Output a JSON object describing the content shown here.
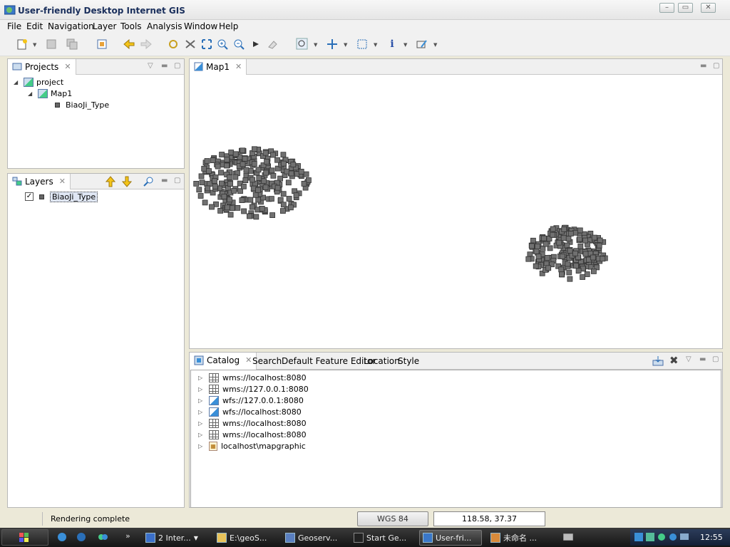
{
  "window": {
    "title": "User-friendly Desktop Internet GIS"
  },
  "menu": [
    "File",
    "Edit",
    "Navigation",
    "Layer",
    "Tools",
    "Analysis",
    "Window",
    "Help"
  ],
  "projects_panel": {
    "tab_label": "Projects",
    "tree": {
      "project": "project",
      "map": "Map1",
      "layer": "BiaoJi_Type"
    }
  },
  "layers_panel": {
    "tab_label": "Layers",
    "layer": {
      "name": "BiaoJi_Type",
      "checked": true
    }
  },
  "map_panel": {
    "tab_label": "Map1"
  },
  "catalog_panel": {
    "tabs": [
      "Catalog",
      "Search",
      "Default Feature Editor",
      "Location",
      "Style"
    ],
    "items": [
      {
        "label": "wms://localhost:8080",
        "icon": "wms-grid-icon"
      },
      {
        "label": "wms://127.0.0.1:8080",
        "icon": "wms-grid-icon"
      },
      {
        "label": "wfs://127.0.0.1:8080",
        "icon": "wfs-icon"
      },
      {
        "label": "wfs://localhost:8080",
        "icon": "wfs-icon"
      },
      {
        "label": "wms://localhost:8080",
        "icon": "wms-grid-icon"
      },
      {
        "label": "wms://localhost:8080",
        "icon": "wms-grid-icon"
      },
      {
        "label": "localhost\\mapgraphic",
        "icon": "mapgraphic-icon"
      }
    ]
  },
  "status": {
    "message": "Rendering complete",
    "crs": "WGS 84",
    "coords": "118.58, 37.37"
  },
  "taskbar": {
    "tasks": [
      "2 Inter...",
      "E:\\geoS...",
      "Geoserv...",
      "Start Ge...",
      "User-fri...",
      "未命名 ..."
    ],
    "clock": "12:55"
  }
}
